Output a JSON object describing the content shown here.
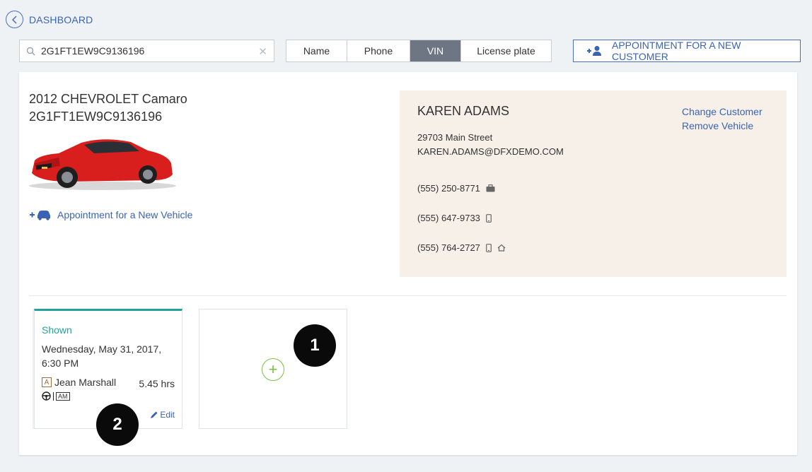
{
  "header": {
    "back_label": "DASHBOARD"
  },
  "search": {
    "value": "2G1FT1EW9C9136196",
    "placeholder": ""
  },
  "search_tabs": [
    "Name",
    "Phone",
    "VIN",
    "License plate"
  ],
  "active_tab": "VIN",
  "new_customer_button": "APPOINTMENT FOR A NEW CUSTOMER",
  "vehicle": {
    "title": "2012 CHEVROLET Camaro",
    "vin": "2G1FT1EW9C9136196",
    "new_vehicle_link": "Appointment for a New Vehicle"
  },
  "customer": {
    "name": "KAREN ADAMS",
    "address": "29703 Main Street",
    "email": "KAREN.ADAMS@DFXDEMO.COM",
    "change_link": "Change Customer",
    "remove_link": "Remove Vehicle",
    "phones": [
      {
        "number": "(555) 250-8771",
        "icons": [
          "briefcase-icon"
        ]
      },
      {
        "number": "(555) 647-9733",
        "icons": [
          "mobile-icon"
        ]
      },
      {
        "number": "(555) 764-2727",
        "icons": [
          "mobile-icon",
          "home-icon"
        ]
      }
    ]
  },
  "appointment": {
    "status": "Shown",
    "date_line1": "Wednesday, May 31, 2017,",
    "date_line2": "6:30 PM",
    "advisor_badge": "A",
    "advisor": "Jean Marshall",
    "hours": "5.45 hrs",
    "am_badge": "AM",
    "edit_label": "Edit"
  },
  "callouts": [
    "1",
    "2"
  ],
  "colors": {
    "accent_blue": "#3a63b5",
    "teal": "#23a29a",
    "green": "#7bc043",
    "customer_bg": "#f6f0e9",
    "active_tab_bg": "#6f7683",
    "car_red": "#d91e1e"
  }
}
